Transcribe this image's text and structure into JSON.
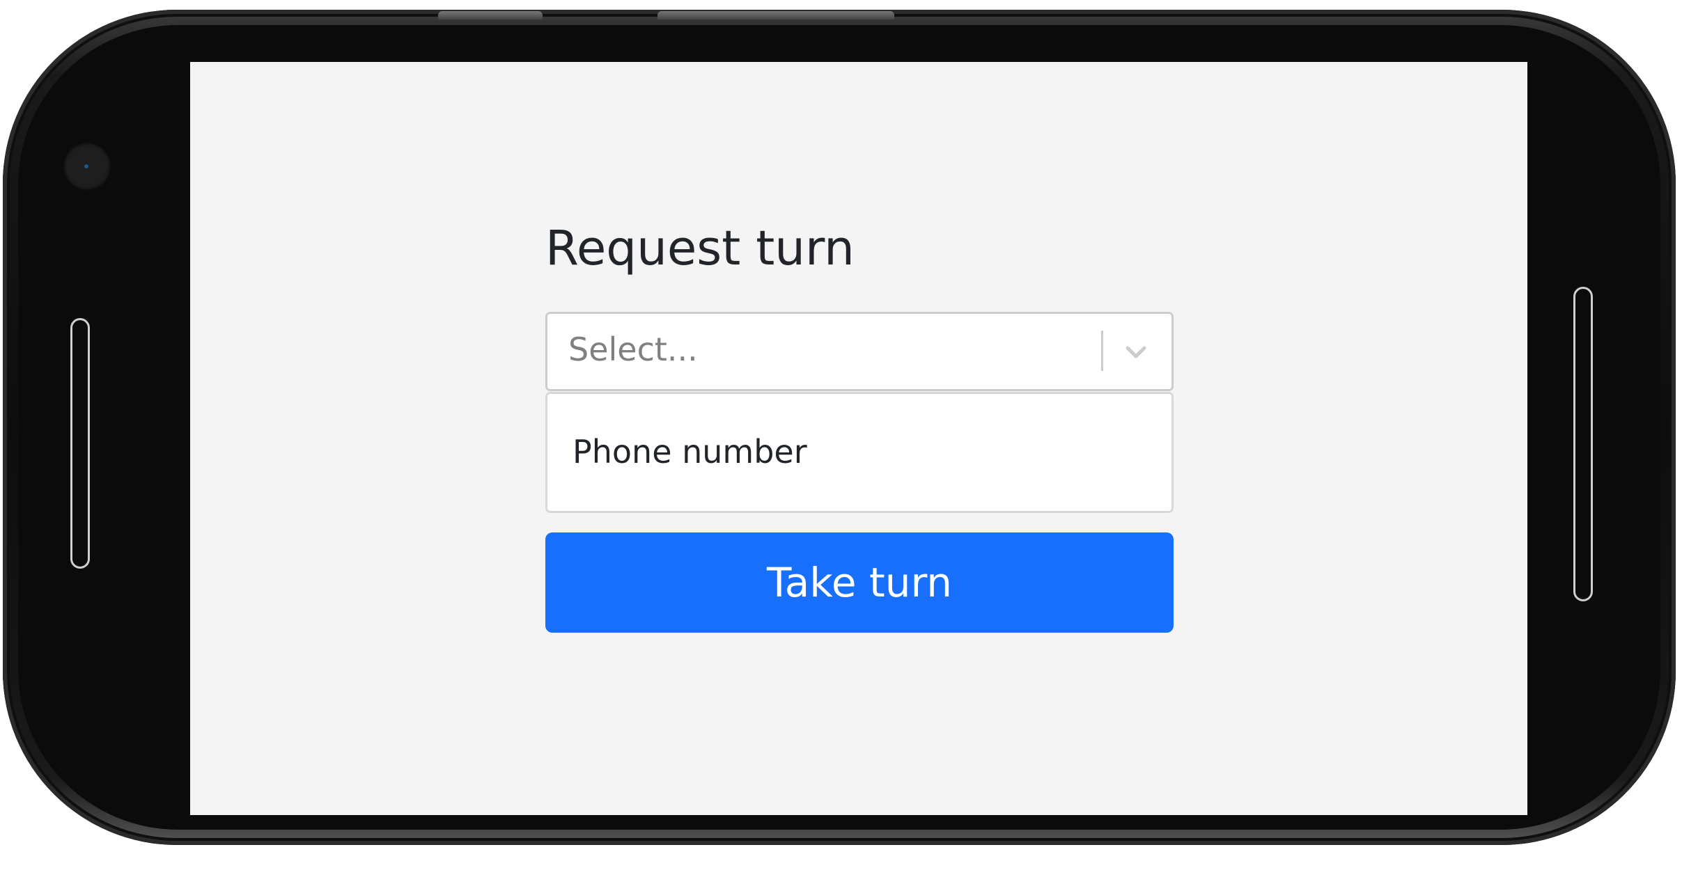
{
  "form": {
    "title": "Request turn",
    "select": {
      "placeholder": "Select...",
      "options": [
        {
          "label": "Phone number"
        }
      ]
    },
    "submit_label": "Take turn"
  },
  "colors": {
    "primary_button": "#176ffb",
    "page_background": "#f4f4f4",
    "text": "#212529",
    "placeholder": "#808080"
  }
}
